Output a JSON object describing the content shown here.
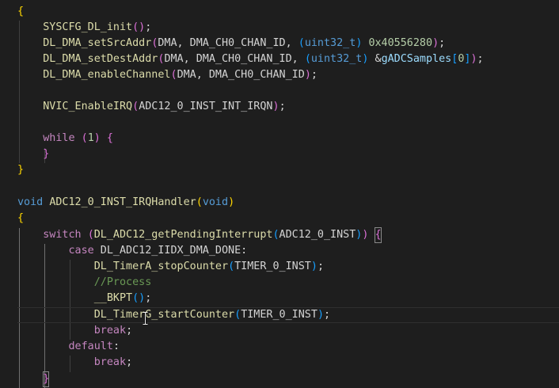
{
  "colors": {
    "background": "#1e1e1e",
    "text": "#d4d4d4",
    "function": "#dcdcaa",
    "keyword_control": "#c586c0",
    "keyword_type": "#569cd6",
    "number": "#b5cea8",
    "variable": "#9cdcfe",
    "comment": "#6a9955",
    "bracket_level1": "#ffd700",
    "bracket_level2": "#da70d6",
    "bracket_level3": "#179fff"
  },
  "mouse_cursor_icon": "i-beam",
  "code": {
    "l1_open": "{",
    "l2_fn": "SYSCFG_DL_init",
    "l2_p": "()",
    "l2_end": ";",
    "l3_fn": "DL_DMA_setSrcAddr",
    "l3_p1": "(",
    "l3_args": "DMA, DMA_CH0_CHAN_ID, ",
    "l3_cast_o": "(",
    "l3_type": "uint32_t",
    "l3_cast_c": ")",
    "l3_sp": " ",
    "l3_num": "0x40556280",
    "l3_p2": ")",
    "l3_end": ";",
    "l4_fn": "DL_DMA_setDestAddr",
    "l4_p1": "(",
    "l4_args": "DMA, DMA_CH0_CHAN_ID, ",
    "l4_cast_o": "(",
    "l4_type": "uint32_t",
    "l4_cast_c": ")",
    "l4_amp": " &",
    "l4_var": "gADCSamples",
    "l4_idx_o": "[",
    "l4_idx": "0",
    "l4_idx_c": "]",
    "l4_p2": ")",
    "l4_end": ";",
    "l5_fn": "DL_DMA_enableChannel",
    "l5_p1": "(",
    "l5_args": "DMA, DMA_CH0_CHAN_ID",
    "l5_p2": ")",
    "l5_end": ";",
    "l7_fn": "NVIC_EnableIRQ",
    "l7_p1": "(",
    "l7_args": "ADC12_0_INST_INT_IRQN",
    "l7_p2": ")",
    "l7_end": ";",
    "l9_kw": "while",
    "l9_sp": " ",
    "l9_p1": "(",
    "l9_num": "1",
    "l9_p2": ")",
    "l9_sp2": " ",
    "l9_brace": "{",
    "l10_brace": "}",
    "l11_close": "}",
    "l13_type": "void",
    "l13_name": "ADC12_0_INST_IRQHandler",
    "l13_p1": "(",
    "l13_arg": "void",
    "l13_p2": ")",
    "l14_open": "{",
    "l15_kw": "switch",
    "l15_sp": " ",
    "l15_p1": "(",
    "l15_fn": "DL_ADC12_getPendingInterrupt",
    "l15_p2": "(",
    "l15_arg": "ADC12_0_INST",
    "l15_p3": ")",
    "l15_p4": ")",
    "l15_sp2": " ",
    "l15_brace": "{",
    "l16_kw": "case",
    "l16_rest": " DL_ADC12_IIDX_DMA_DONE:",
    "l17_fn": "DL_TimerA_stopCounter",
    "l17_p1": "(",
    "l17_arg": "TIMER_0_INST",
    "l17_p2": ")",
    "l17_end": ";",
    "l18_comment": "//Process",
    "l19_fn": "__BKPT",
    "l19_p": "()",
    "l19_end": ";",
    "l20_fn": "DL_TimerG_startCounter",
    "l20_p1": "(",
    "l20_arg": "TIMER_0_INST",
    "l20_p2": ")",
    "l20_end": ";",
    "l21_kw": "break",
    "l21_end": ";",
    "l22_kw": "default",
    "l22_end": ":",
    "l23_kw": "break",
    "l23_end": ";",
    "l24_brace": "}"
  }
}
